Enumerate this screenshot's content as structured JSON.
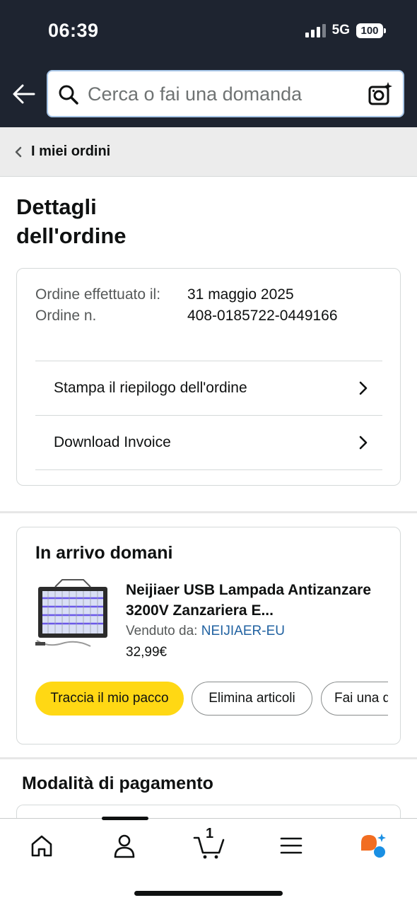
{
  "status_bar": {
    "time": "06:39",
    "network": "5G",
    "battery": "100"
  },
  "search": {
    "placeholder": "Cerca o fai una domanda"
  },
  "breadcrumb": {
    "label": "I miei ordini"
  },
  "page": {
    "title": "Dettagli dell'ordine"
  },
  "order_summary": {
    "date_label": "Ordine effettuato il:",
    "date_value": "31 maggio 2025",
    "number_label": "Ordine n.",
    "number_value": "408-0185722-0449166",
    "links": [
      {
        "label": "Stampa il riepilogo dell'ordine"
      },
      {
        "label": "Download Invoice"
      }
    ]
  },
  "shipment": {
    "status": "In arrivo domani",
    "product_title": "Neijiaer USB Lampada Antizanzare 3200V Zanzariera E...",
    "sold_by_label": "Venduto da:",
    "seller": "NEIJIAER-EU",
    "price": "32,99€",
    "buttons": [
      {
        "label": "Traccia il mio pacco"
      },
      {
        "label": "Elimina articoli"
      },
      {
        "label": "Fai una domanda"
      }
    ]
  },
  "payment": {
    "title": "Modalità di pagamento"
  },
  "bottom_nav": {
    "items": [
      "home-icon",
      "account-icon",
      "cart-icon",
      "menu-icon",
      "rufus-icon"
    ],
    "cart_count": "1"
  },
  "colors": {
    "header_bg": "#1e2430",
    "primary_button": "#ffd814",
    "link": "#2162a1"
  }
}
